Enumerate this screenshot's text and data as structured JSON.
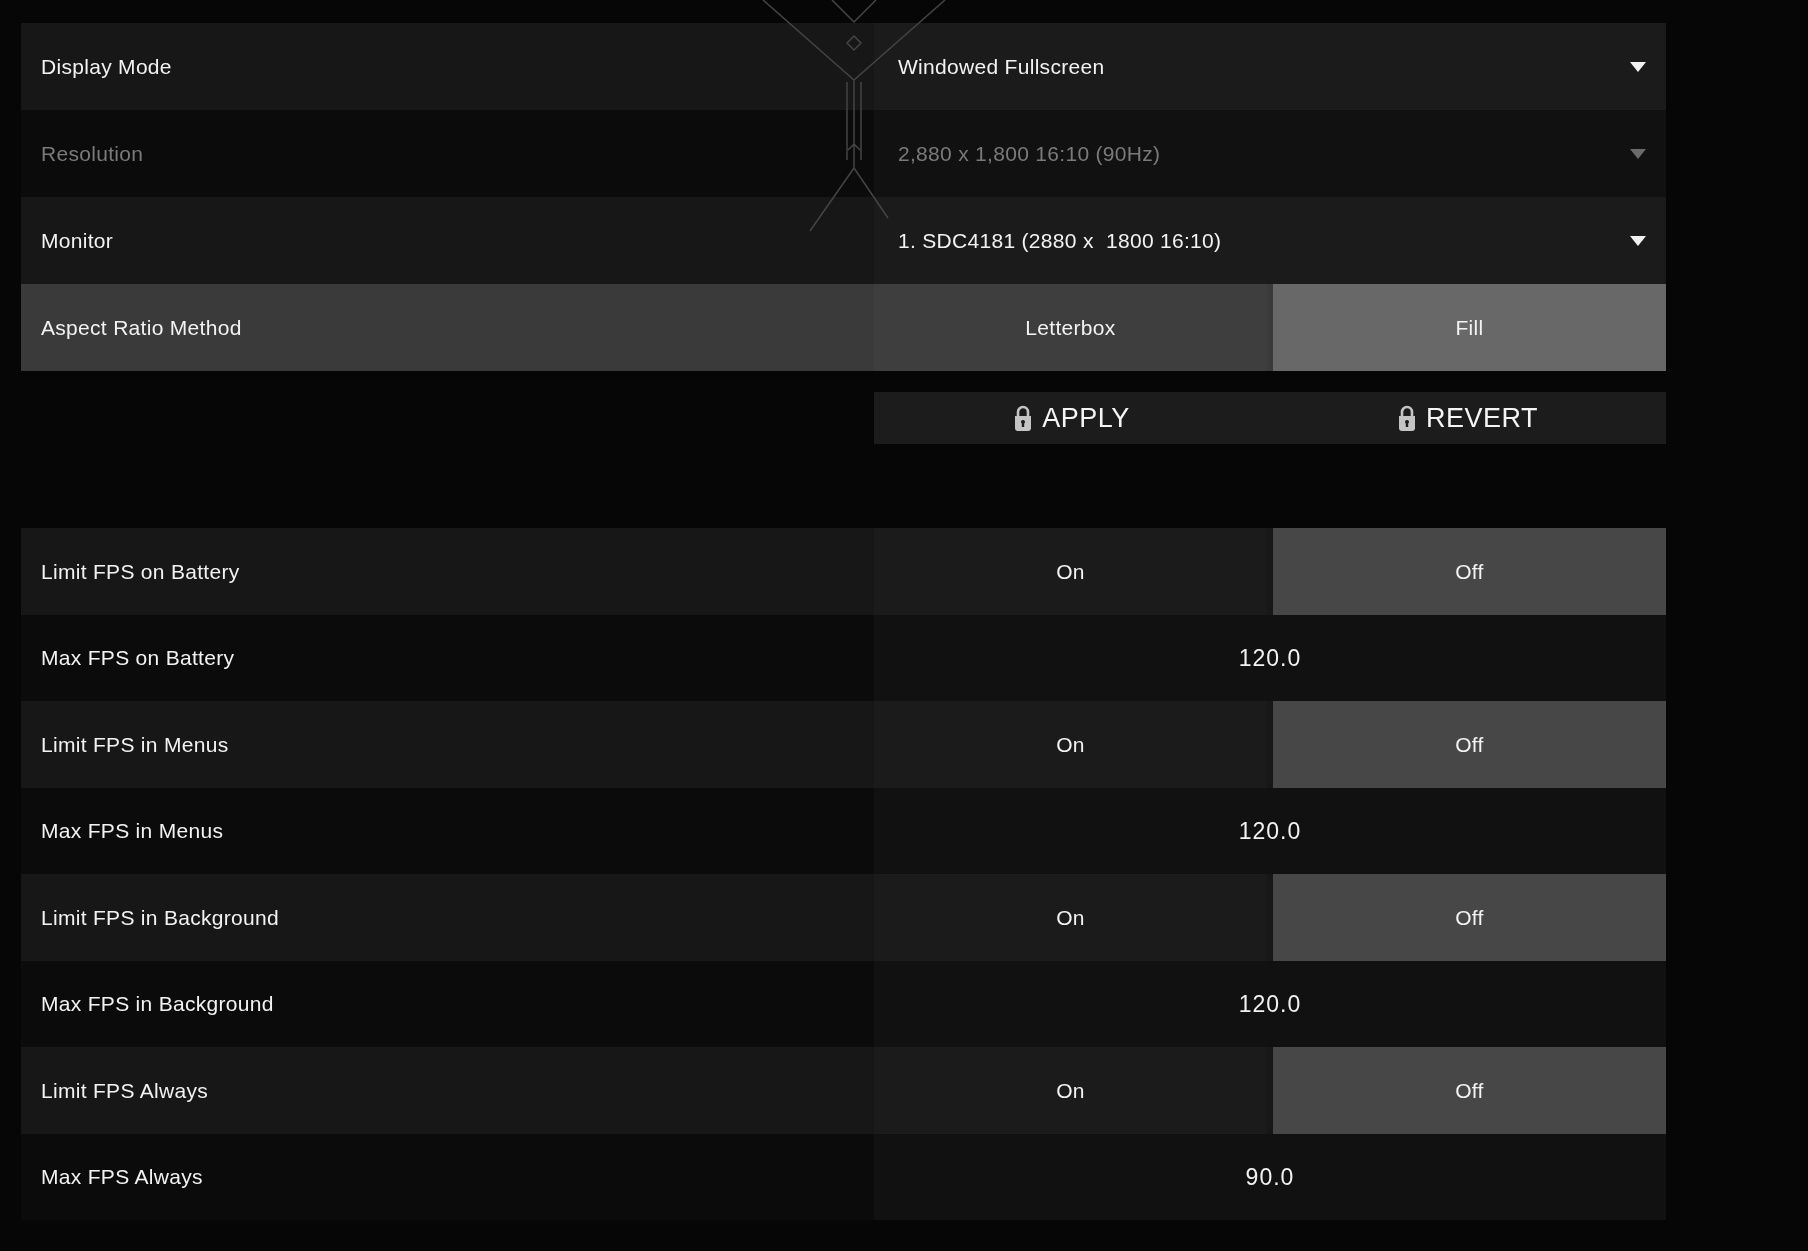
{
  "display_settings": [
    {
      "kind": "dropdown",
      "label": "Display Mode",
      "value": "Windowed Fullscreen",
      "disabled": false,
      "highlighted": false
    },
    {
      "kind": "dropdown",
      "label": "Resolution",
      "value": "2,880 x 1,800 16:10 (90Hz)",
      "disabled": true,
      "highlighted": false
    },
    {
      "kind": "dropdown",
      "label": "Monitor",
      "value": "1. SDC4181 (2880 x  1800 16:10)",
      "disabled": false,
      "highlighted": false
    },
    {
      "kind": "toggle",
      "label": "Aspect Ratio Method",
      "disabled": false,
      "highlighted": true,
      "options": [
        {
          "label": "Letterbox",
          "selected": false
        },
        {
          "label": "Fill",
          "selected": true
        }
      ]
    }
  ],
  "actions": [
    {
      "label": "APPLY",
      "locked": true
    },
    {
      "label": "REVERT",
      "locked": true
    }
  ],
  "fps_settings": [
    {
      "kind": "toggle",
      "label": "Limit FPS on Battery",
      "disabled": false,
      "highlighted": false,
      "options": [
        {
          "label": "On",
          "selected": false
        },
        {
          "label": "Off",
          "selected": true
        }
      ]
    },
    {
      "kind": "value",
      "label": "Max FPS on Battery",
      "value": "120.0",
      "disabled": false,
      "highlighted": false
    },
    {
      "kind": "toggle",
      "label": "Limit FPS in Menus",
      "disabled": false,
      "highlighted": false,
      "options": [
        {
          "label": "On",
          "selected": false
        },
        {
          "label": "Off",
          "selected": true
        }
      ]
    },
    {
      "kind": "value",
      "label": "Max FPS in Menus",
      "value": "120.0",
      "disabled": false,
      "highlighted": false
    },
    {
      "kind": "toggle",
      "label": "Limit FPS in Background",
      "disabled": false,
      "highlighted": false,
      "options": [
        {
          "label": "On",
          "selected": false
        },
        {
          "label": "Off",
          "selected": true
        }
      ]
    },
    {
      "kind": "value",
      "label": "Max FPS in Background",
      "value": "120.0",
      "disabled": false,
      "highlighted": false
    },
    {
      "kind": "toggle",
      "label": "Limit FPS Always",
      "disabled": false,
      "highlighted": false,
      "options": [
        {
          "label": "On",
          "selected": false
        },
        {
          "label": "Off",
          "selected": true
        }
      ]
    },
    {
      "kind": "value",
      "label": "Max FPS Always",
      "value": "90.0",
      "disabled": false,
      "highlighted": false
    }
  ]
}
